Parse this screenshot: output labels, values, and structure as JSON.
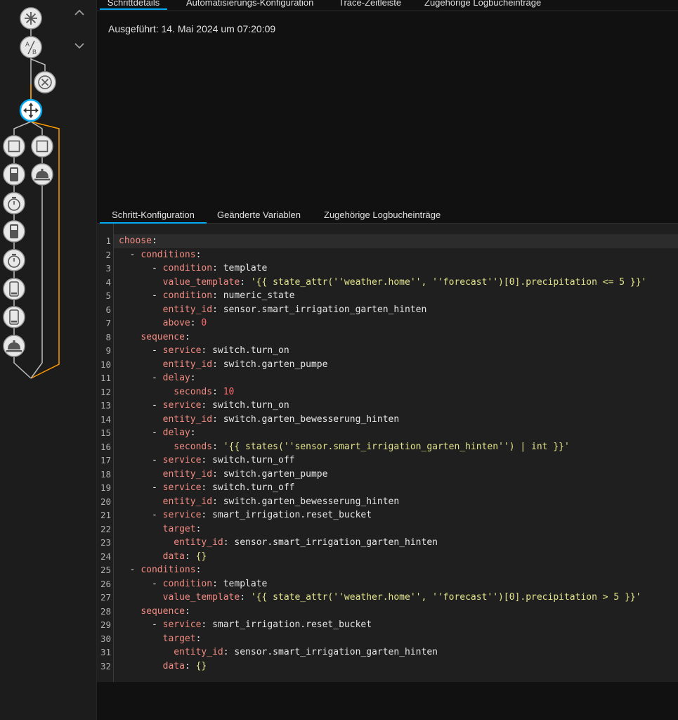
{
  "top_tabs": [
    {
      "label": "Schrittdetails",
      "active": true
    },
    {
      "label": "Automatisierungs-Konfiguration",
      "active": false
    },
    {
      "label": "Trace-Zeitleiste",
      "active": false
    },
    {
      "label": "Zugehörige Logbucheinträge",
      "active": false
    }
  ],
  "executed": "Ausgeführt: 14. Mai 2024 um 07:20:09",
  "sub_tabs": [
    {
      "label": "Schritt-Konfiguration",
      "active": true
    },
    {
      "label": "Geänderte Variablen",
      "active": false
    },
    {
      "label": "Zugehörige Logbucheinträge",
      "active": false
    }
  ],
  "graph_nodes": [
    {
      "icon": "asterisk-trigger-icon",
      "active": false
    },
    {
      "icon": "a-b-condition-icon",
      "active": false
    },
    {
      "icon": "close-x-icon",
      "active": false
    },
    {
      "icon": "choose-arrows-icon",
      "active": true
    },
    {
      "icon": "square-action-icon",
      "active": false
    },
    {
      "icon": "square-action-icon",
      "active": false
    },
    {
      "icon": "switch-device-icon",
      "active": false
    },
    {
      "icon": "service-bell-icon",
      "active": false
    },
    {
      "icon": "timer-icon",
      "active": false
    },
    {
      "icon": "switch-device-icon",
      "active": false
    },
    {
      "icon": "timer-icon",
      "active": false
    },
    {
      "icon": "phone-device-icon",
      "active": false
    },
    {
      "icon": "phone-device-icon",
      "active": false
    },
    {
      "icon": "service-bell-icon",
      "active": false
    }
  ],
  "colors": {
    "accent": "#03a9f4",
    "trace": "#ff9800",
    "key": "#f28b82",
    "string": "#e3e48b",
    "number": "#ff6b6b"
  },
  "yaml_lines": [
    {
      "num": "1",
      "tokens": [
        {
          "t": "choose",
          "c": "k"
        },
        {
          "t": ":",
          "c": "p"
        }
      ]
    },
    {
      "num": "2",
      "tokens": [
        {
          "t": "  - ",
          "c": "p"
        },
        {
          "t": "conditions",
          "c": "k"
        },
        {
          "t": ":",
          "c": "p"
        }
      ]
    },
    {
      "num": "3",
      "tokens": [
        {
          "t": "      - ",
          "c": "p"
        },
        {
          "t": "condition",
          "c": "k"
        },
        {
          "t": ": template",
          "c": "p"
        }
      ]
    },
    {
      "num": "4",
      "tokens": [
        {
          "t": "        ",
          "c": "p"
        },
        {
          "t": "value_template",
          "c": "k"
        },
        {
          "t": ": ",
          "c": "p"
        },
        {
          "t": "'{{ state_attr(''weather.home'', ''forecast'')[0].precipitation <= 5 }}'",
          "c": "s"
        }
      ]
    },
    {
      "num": "5",
      "tokens": [
        {
          "t": "      - ",
          "c": "p"
        },
        {
          "t": "condition",
          "c": "k"
        },
        {
          "t": ": numeric_state",
          "c": "p"
        }
      ]
    },
    {
      "num": "6",
      "tokens": [
        {
          "t": "        ",
          "c": "p"
        },
        {
          "t": "entity_id",
          "c": "k"
        },
        {
          "t": ": sensor.smart_irrigation_garten_hinten",
          "c": "p"
        }
      ]
    },
    {
      "num": "7",
      "tokens": [
        {
          "t": "        ",
          "c": "p"
        },
        {
          "t": "above",
          "c": "k"
        },
        {
          "t": ": ",
          "c": "p"
        },
        {
          "t": "0",
          "c": "n"
        }
      ]
    },
    {
      "num": "8",
      "tokens": [
        {
          "t": "    ",
          "c": "p"
        },
        {
          "t": "sequence",
          "c": "k"
        },
        {
          "t": ":",
          "c": "p"
        }
      ]
    },
    {
      "num": "9",
      "tokens": [
        {
          "t": "      - ",
          "c": "p"
        },
        {
          "t": "service",
          "c": "k"
        },
        {
          "t": ": switch.turn_on",
          "c": "p"
        }
      ]
    },
    {
      "num": "10",
      "tokens": [
        {
          "t": "        ",
          "c": "p"
        },
        {
          "t": "entity_id",
          "c": "k"
        },
        {
          "t": ": switch.garten_pumpe",
          "c": "p"
        }
      ]
    },
    {
      "num": "11",
      "tokens": [
        {
          "t": "      - ",
          "c": "p"
        },
        {
          "t": "delay",
          "c": "k"
        },
        {
          "t": ":",
          "c": "p"
        }
      ]
    },
    {
      "num": "12",
      "tokens": [
        {
          "t": "          ",
          "c": "p"
        },
        {
          "t": "seconds",
          "c": "k"
        },
        {
          "t": ": ",
          "c": "p"
        },
        {
          "t": "10",
          "c": "n"
        }
      ]
    },
    {
      "num": "13",
      "tokens": [
        {
          "t": "      - ",
          "c": "p"
        },
        {
          "t": "service",
          "c": "k"
        },
        {
          "t": ": switch.turn_on",
          "c": "p"
        }
      ]
    },
    {
      "num": "14",
      "tokens": [
        {
          "t": "        ",
          "c": "p"
        },
        {
          "t": "entity_id",
          "c": "k"
        },
        {
          "t": ": switch.garten_bewesserung_hinten",
          "c": "p"
        }
      ]
    },
    {
      "num": "15",
      "tokens": [
        {
          "t": "      - ",
          "c": "p"
        },
        {
          "t": "delay",
          "c": "k"
        },
        {
          "t": ":",
          "c": "p"
        }
      ]
    },
    {
      "num": "16",
      "tokens": [
        {
          "t": "          ",
          "c": "p"
        },
        {
          "t": "seconds",
          "c": "k"
        },
        {
          "t": ": ",
          "c": "p"
        },
        {
          "t": "'{{ states(''sensor.smart_irrigation_garten_hinten'') | int }}'",
          "c": "s"
        }
      ]
    },
    {
      "num": "17",
      "tokens": [
        {
          "t": "      - ",
          "c": "p"
        },
        {
          "t": "service",
          "c": "k"
        },
        {
          "t": ": switch.turn_off",
          "c": "p"
        }
      ]
    },
    {
      "num": "18",
      "tokens": [
        {
          "t": "        ",
          "c": "p"
        },
        {
          "t": "entity_id",
          "c": "k"
        },
        {
          "t": ": switch.garten_pumpe",
          "c": "p"
        }
      ]
    },
    {
      "num": "19",
      "tokens": [
        {
          "t": "      - ",
          "c": "p"
        },
        {
          "t": "service",
          "c": "k"
        },
        {
          "t": ": switch.turn_off",
          "c": "p"
        }
      ]
    },
    {
      "num": "20",
      "tokens": [
        {
          "t": "        ",
          "c": "p"
        },
        {
          "t": "entity_id",
          "c": "k"
        },
        {
          "t": ": switch.garten_bewesserung_hinten",
          "c": "p"
        }
      ]
    },
    {
      "num": "21",
      "tokens": [
        {
          "t": "      - ",
          "c": "p"
        },
        {
          "t": "service",
          "c": "k"
        },
        {
          "t": ": smart_irrigation.reset_bucket",
          "c": "p"
        }
      ]
    },
    {
      "num": "22",
      "tokens": [
        {
          "t": "        ",
          "c": "p"
        },
        {
          "t": "target",
          "c": "k"
        },
        {
          "t": ":",
          "c": "p"
        }
      ]
    },
    {
      "num": "23",
      "tokens": [
        {
          "t": "          ",
          "c": "p"
        },
        {
          "t": "entity_id",
          "c": "k"
        },
        {
          "t": ": sensor.smart_irrigation_garten_hinten",
          "c": "p"
        }
      ]
    },
    {
      "num": "24",
      "tokens": [
        {
          "t": "        ",
          "c": "p"
        },
        {
          "t": "data",
          "c": "k"
        },
        {
          "t": ": ",
          "c": "p"
        },
        {
          "t": "{}",
          "c": "s"
        }
      ]
    },
    {
      "num": "25",
      "tokens": [
        {
          "t": "  - ",
          "c": "p"
        },
        {
          "t": "conditions",
          "c": "k"
        },
        {
          "t": ":",
          "c": "p"
        }
      ]
    },
    {
      "num": "26",
      "tokens": [
        {
          "t": "      - ",
          "c": "p"
        },
        {
          "t": "condition",
          "c": "k"
        },
        {
          "t": ": template",
          "c": "p"
        }
      ]
    },
    {
      "num": "27",
      "tokens": [
        {
          "t": "        ",
          "c": "p"
        },
        {
          "t": "value_template",
          "c": "k"
        },
        {
          "t": ": ",
          "c": "p"
        },
        {
          "t": "'{{ state_attr(''weather.home'', ''forecast'')[0].precipitation > 5 }}'",
          "c": "s"
        }
      ]
    },
    {
      "num": "28",
      "tokens": [
        {
          "t": "    ",
          "c": "p"
        },
        {
          "t": "sequence",
          "c": "k"
        },
        {
          "t": ":",
          "c": "p"
        }
      ]
    },
    {
      "num": "29",
      "tokens": [
        {
          "t": "      - ",
          "c": "p"
        },
        {
          "t": "service",
          "c": "k"
        },
        {
          "t": ": smart_irrigation.reset_bucket",
          "c": "p"
        }
      ]
    },
    {
      "num": "30",
      "tokens": [
        {
          "t": "        ",
          "c": "p"
        },
        {
          "t": "target",
          "c": "k"
        },
        {
          "t": ":",
          "c": "p"
        }
      ]
    },
    {
      "num": "31",
      "tokens": [
        {
          "t": "          ",
          "c": "p"
        },
        {
          "t": "entity_id",
          "c": "k"
        },
        {
          "t": ": sensor.smart_irrigation_garten_hinten",
          "c": "p"
        }
      ]
    },
    {
      "num": "32",
      "tokens": [
        {
          "t": "        ",
          "c": "p"
        },
        {
          "t": "data",
          "c": "k"
        },
        {
          "t": ": ",
          "c": "p"
        },
        {
          "t": "{}",
          "c": "s"
        }
      ]
    }
  ]
}
